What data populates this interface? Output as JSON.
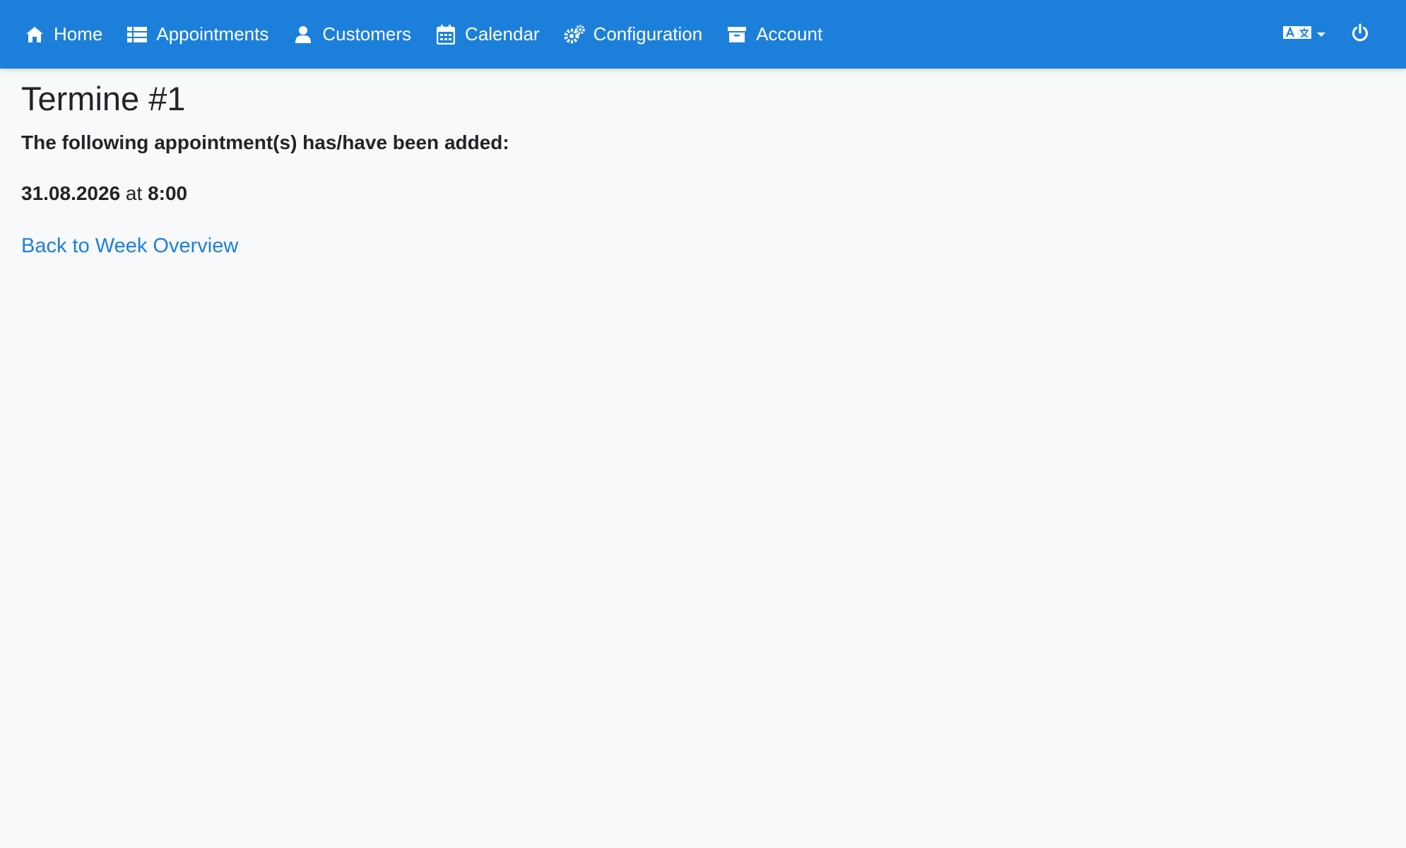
{
  "nav": {
    "items": [
      {
        "label": "Home",
        "icon": "home-icon"
      },
      {
        "label": "Appointments",
        "icon": "list-icon"
      },
      {
        "label": "Customers",
        "icon": "user-icon"
      },
      {
        "label": "Calendar",
        "icon": "calendar-icon"
      },
      {
        "label": "Configuration",
        "icon": "cogs-icon"
      },
      {
        "label": "Account",
        "icon": "archive-icon"
      }
    ],
    "language_icon": "language-icon",
    "power_icon": "power-icon"
  },
  "page": {
    "title": "Termine #1",
    "notice": "The following appointment(s) has/have been added:",
    "appointment": {
      "date": "31.08.2026",
      "connector": " at ",
      "time": "8:00"
    },
    "back_link": "Back to Week Overview"
  },
  "colors": {
    "navbar": "#1c80db",
    "link": "#1c80db",
    "background": "#f8f9fa"
  }
}
